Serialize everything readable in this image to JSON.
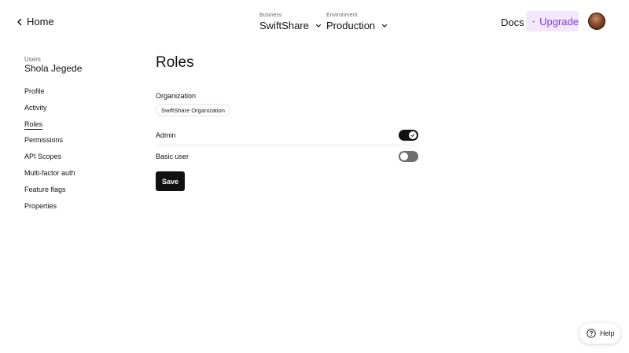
{
  "topbar": {
    "home_label": "Home",
    "business": {
      "caption": "Business",
      "value": "SwiftShare"
    },
    "environment": {
      "caption": "Environment",
      "value": "Production"
    },
    "docs_label": "Docs",
    "upgrade_label": "Upgrade"
  },
  "sidebar": {
    "caption": "Users",
    "user_name": "Shola Jegede",
    "items": [
      {
        "label": "Profile"
      },
      {
        "label": "Activity"
      },
      {
        "label": "Roles"
      },
      {
        "label": "Permissions"
      },
      {
        "label": "API Scopes"
      },
      {
        "label": "Multi-factor auth"
      },
      {
        "label": "Feature flags"
      },
      {
        "label": "Properties"
      }
    ],
    "active_item": "Roles"
  },
  "main": {
    "title": "Roles",
    "organization_label": "Organization",
    "organization_chip": "SwiftShare Organization",
    "roles": [
      {
        "label": "Admin",
        "enabled": true
      },
      {
        "label": "Basic user",
        "enabled": false
      }
    ],
    "save_label": "Save"
  },
  "help_label": "Help",
  "colors": {
    "accent_purple": "#7a3fd6",
    "upgrade_bg": "#f3e8fd",
    "toggle_on": "#111111",
    "toggle_off": "#6e6e6e"
  }
}
